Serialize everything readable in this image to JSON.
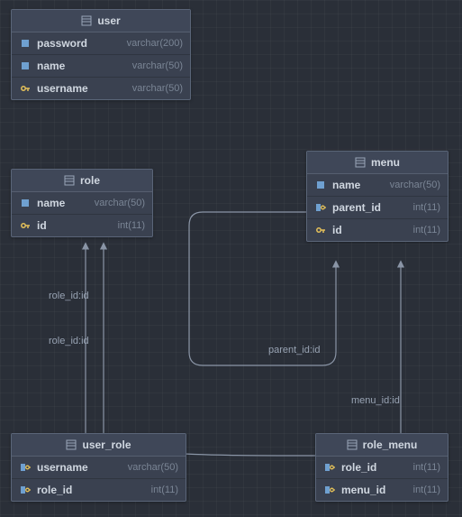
{
  "tables": {
    "user": {
      "title": "user",
      "columns": [
        {
          "icon": "col",
          "name": "password",
          "type": "varchar(200)"
        },
        {
          "icon": "col",
          "name": "name",
          "type": "varchar(50)"
        },
        {
          "icon": "key",
          "name": "username",
          "type": "varchar(50)"
        }
      ]
    },
    "role": {
      "title": "role",
      "columns": [
        {
          "icon": "col",
          "name": "name",
          "type": "varchar(50)"
        },
        {
          "icon": "key",
          "name": "id",
          "type": "int(11)"
        }
      ]
    },
    "menu": {
      "title": "menu",
      "columns": [
        {
          "icon": "col",
          "name": "name",
          "type": "varchar(50)"
        },
        {
          "icon": "fk",
          "name": "parent_id",
          "type": "int(11)"
        },
        {
          "icon": "key",
          "name": "id",
          "type": "int(11)"
        }
      ]
    },
    "user_role": {
      "title": "user_role",
      "columns": [
        {
          "icon": "fk",
          "name": "username",
          "type": "varchar(50)"
        },
        {
          "icon": "fk",
          "name": "role_id",
          "type": "int(11)"
        }
      ]
    },
    "role_menu": {
      "title": "role_menu",
      "columns": [
        {
          "icon": "fk",
          "name": "role_id",
          "type": "int(11)"
        },
        {
          "icon": "fk",
          "name": "menu_id",
          "type": "int(11)"
        }
      ]
    }
  },
  "relations": {
    "r1": "role_id:id",
    "r2": "role_id:id",
    "r3": "parent_id:id",
    "r4": "menu_id:id"
  },
  "chart_data": {
    "type": "table",
    "description": "Entity-relationship diagram with 5 tables",
    "entities": [
      {
        "name": "user",
        "columns": [
          {
            "name": "password",
            "type": "varchar(200)",
            "pk": false,
            "fk": false
          },
          {
            "name": "name",
            "type": "varchar(50)",
            "pk": false,
            "fk": false
          },
          {
            "name": "username",
            "type": "varchar(50)",
            "pk": true,
            "fk": false
          }
        ]
      },
      {
        "name": "role",
        "columns": [
          {
            "name": "name",
            "type": "varchar(50)",
            "pk": false,
            "fk": false
          },
          {
            "name": "id",
            "type": "int(11)",
            "pk": true,
            "fk": false
          }
        ]
      },
      {
        "name": "menu",
        "columns": [
          {
            "name": "name",
            "type": "varchar(50)",
            "pk": false,
            "fk": false
          },
          {
            "name": "parent_id",
            "type": "int(11)",
            "pk": false,
            "fk": true
          },
          {
            "name": "id",
            "type": "int(11)",
            "pk": true,
            "fk": false
          }
        ]
      },
      {
        "name": "user_role",
        "columns": [
          {
            "name": "username",
            "type": "varchar(50)",
            "pk": false,
            "fk": true
          },
          {
            "name": "role_id",
            "type": "int(11)",
            "pk": false,
            "fk": true
          }
        ]
      },
      {
        "name": "role_menu",
        "columns": [
          {
            "name": "role_id",
            "type": "int(11)",
            "pk": false,
            "fk": true
          },
          {
            "name": "menu_id",
            "type": "int(11)",
            "pk": false,
            "fk": true
          }
        ]
      }
    ],
    "relationships": [
      {
        "from": "user_role.role_id",
        "to": "role.id",
        "label": "role_id:id"
      },
      {
        "from": "role_menu.role_id",
        "to": "role.id",
        "label": "role_id:id"
      },
      {
        "from": "menu.parent_id",
        "to": "menu.id",
        "label": "parent_id:id"
      },
      {
        "from": "role_menu.menu_id",
        "to": "menu.id",
        "label": "menu_id:id"
      }
    ]
  }
}
